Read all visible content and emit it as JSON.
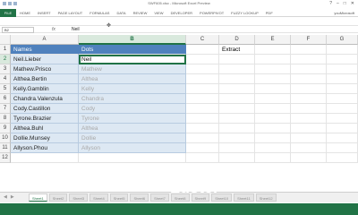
{
  "window": {
    "title": "SWF605.xlsx - Microsoft Excel Preview",
    "controls": [
      "?",
      "–",
      "□",
      "✕"
    ]
  },
  "ribbon": {
    "file_tab": "FILE",
    "tabs": [
      "HOME",
      "INSERT",
      "PAGE LAYOUT",
      "FORMULAS",
      "DATA",
      "REVIEW",
      "VIEW",
      "DEVELOPER",
      "POWERPIVOT",
      "FUZZY LOOKUP",
      "PDF"
    ],
    "account": "youMicrosoft"
  },
  "formula_bar": {
    "name_box": "B2",
    "fx_label": "fx",
    "value": "Neil"
  },
  "grid": {
    "columns": [
      "A",
      "B",
      "C",
      "D",
      "E",
      "F",
      "G"
    ],
    "selected_column": "B",
    "rows": [
      "1",
      "2",
      "3",
      "4",
      "5",
      "6",
      "7",
      "8",
      "9",
      "10",
      "11",
      "12"
    ],
    "selected_row": "2",
    "header_row": {
      "names": "Names",
      "dots": "Dots"
    },
    "extract_label": "Extract",
    "names": [
      "Neil.Lieber",
      "Mathew.Prisco",
      "Althea.Bertin",
      "Kelly.Gamblin",
      "Chandra.Valenzula",
      "Cody.Castillon",
      "Tyrone.Brazier",
      "Althea.Buhl",
      "Dollie.Munsey",
      "Allyson.Phou"
    ],
    "dots": [
      "Neil",
      "Mathew",
      "Althea",
      "Kelly",
      "Chandra",
      "Cody",
      "Tyrone",
      "Althea",
      "Dollie",
      "Allyson"
    ]
  },
  "sheet_tabs": [
    "Sheet1",
    "Sheet2",
    "Sheet3",
    "Sheet4",
    "Sheet5",
    "Sheet6",
    "Sheet7",
    "Sheet8",
    "Sheet9",
    "Sheet10",
    "Sheet11",
    "Sheet12"
  ],
  "watermark": {
    "line1": "Mind",
    "line2": "Luster"
  },
  "colors": {
    "excel_green": "#217346",
    "table_header": "#4f81bd",
    "table_band": "#dde8f3",
    "ghost_text": "#a9a9a9"
  }
}
